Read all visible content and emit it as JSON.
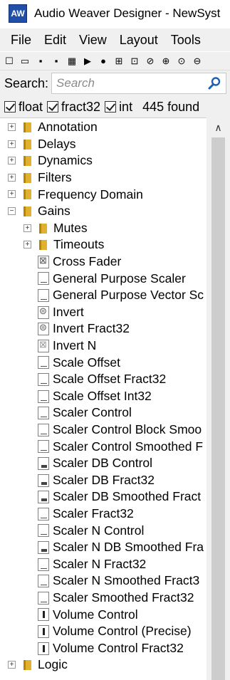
{
  "window": {
    "title": "Audio Weaver Designer - NewSyst",
    "logo_text": "AW"
  },
  "menu": [
    "File",
    "Edit",
    "View",
    "Layout",
    "Tools"
  ],
  "toolbar": {
    "icons": [
      {
        "name": "new-file-icon",
        "glyph": "☐"
      },
      {
        "name": "open-folder-icon",
        "glyph": "▭"
      },
      {
        "name": "save-icon",
        "glyph": "▪"
      },
      {
        "name": "save-as-icon",
        "glyph": "▪"
      },
      {
        "name": "build-icon",
        "glyph": "▦"
      },
      {
        "name": "run-icon",
        "glyph": "▶"
      },
      {
        "name": "stop-icon",
        "glyph": "●"
      },
      {
        "name": "layout-icon",
        "glyph": "⊞"
      },
      {
        "name": "debug-icon",
        "glyph": "⊡"
      },
      {
        "name": "no-entry-icon",
        "glyph": "⊘"
      },
      {
        "name": "zoom-in-icon",
        "glyph": "⊕"
      },
      {
        "name": "zoom-fit-icon",
        "glyph": "⊙"
      },
      {
        "name": "zoom-out-icon",
        "glyph": "⊖"
      }
    ]
  },
  "search": {
    "label": "Search:",
    "placeholder": "Search",
    "value": ""
  },
  "filters": {
    "items": [
      {
        "label": "float",
        "checked": true
      },
      {
        "label": "fract32",
        "checked": true
      },
      {
        "label": "int",
        "checked": true
      }
    ],
    "found_text": "445 found"
  },
  "tree": [
    {
      "type": "folder",
      "level": 0,
      "expander": "+",
      "label": "Annotation"
    },
    {
      "type": "folder",
      "level": 0,
      "expander": "+",
      "label": "Delays"
    },
    {
      "type": "folder",
      "level": 0,
      "expander": "+",
      "label": "Dynamics"
    },
    {
      "type": "folder",
      "level": 0,
      "expander": "+",
      "label": "Filters"
    },
    {
      "type": "folder",
      "level": 0,
      "expander": "+",
      "label": "Frequency Domain"
    },
    {
      "type": "folder",
      "level": 0,
      "expander": "−",
      "label": "Gains"
    },
    {
      "type": "folder",
      "level": 1,
      "expander": "+",
      "label": "Mutes"
    },
    {
      "type": "folder",
      "level": 1,
      "expander": "+",
      "label": "Timeouts"
    },
    {
      "type": "module",
      "level": 1,
      "icon": "fader",
      "label": "Cross Fader"
    },
    {
      "type": "module",
      "level": 1,
      "icon": "scaler",
      "label": "General Purpose Scaler"
    },
    {
      "type": "module",
      "level": 1,
      "icon": "scaler",
      "label": "General Purpose Vector Sc"
    },
    {
      "type": "module",
      "level": 1,
      "icon": "invert",
      "label": "Invert"
    },
    {
      "type": "module",
      "level": 1,
      "icon": "invert",
      "label": "Invert Fract32"
    },
    {
      "type": "module",
      "level": 1,
      "icon": "invertn",
      "label": "Invert N"
    },
    {
      "type": "module",
      "level": 1,
      "icon": "scaler",
      "label": "Scale Offset"
    },
    {
      "type": "module",
      "level": 1,
      "icon": "scaler",
      "label": "Scale Offset Fract32"
    },
    {
      "type": "module",
      "level": 1,
      "icon": "scaler",
      "label": "Scale Offset Int32"
    },
    {
      "type": "module",
      "level": 1,
      "icon": "scaler",
      "label": "Scaler Control"
    },
    {
      "type": "module",
      "level": 1,
      "icon": "scaler",
      "label": "Scaler Control Block Smoo"
    },
    {
      "type": "module",
      "level": 1,
      "icon": "scaler",
      "label": "Scaler Control Smoothed F"
    },
    {
      "type": "module",
      "level": 1,
      "icon": "db",
      "label": "Scaler DB Control"
    },
    {
      "type": "module",
      "level": 1,
      "icon": "db",
      "label": "Scaler DB Fract32"
    },
    {
      "type": "module",
      "level": 1,
      "icon": "db",
      "label": "Scaler DB Smoothed Fract"
    },
    {
      "type": "module",
      "level": 1,
      "icon": "scaler",
      "label": "Scaler Fract32"
    },
    {
      "type": "module",
      "level": 1,
      "icon": "scaler",
      "label": "Scaler N Control"
    },
    {
      "type": "module",
      "level": 1,
      "icon": "db",
      "label": "Scaler N DB Smoothed Fra"
    },
    {
      "type": "module",
      "level": 1,
      "icon": "scaler",
      "label": "Scaler N Fract32"
    },
    {
      "type": "module",
      "level": 1,
      "icon": "scaler",
      "label": "Scaler N Smoothed Fract3"
    },
    {
      "type": "module",
      "level": 1,
      "icon": "scaler",
      "label": "Scaler Smoothed Fract32"
    },
    {
      "type": "module",
      "level": 1,
      "icon": "volume",
      "label": "Volume Control"
    },
    {
      "type": "module",
      "level": 1,
      "icon": "volume",
      "label": "Volume Control (Precise)"
    },
    {
      "type": "module",
      "level": 1,
      "icon": "volume",
      "label": "Volume Control Fract32"
    },
    {
      "type": "folder",
      "level": 0,
      "expander": "+",
      "label": "Logic"
    }
  ],
  "scrollbar": {
    "up_glyph": "∧"
  }
}
